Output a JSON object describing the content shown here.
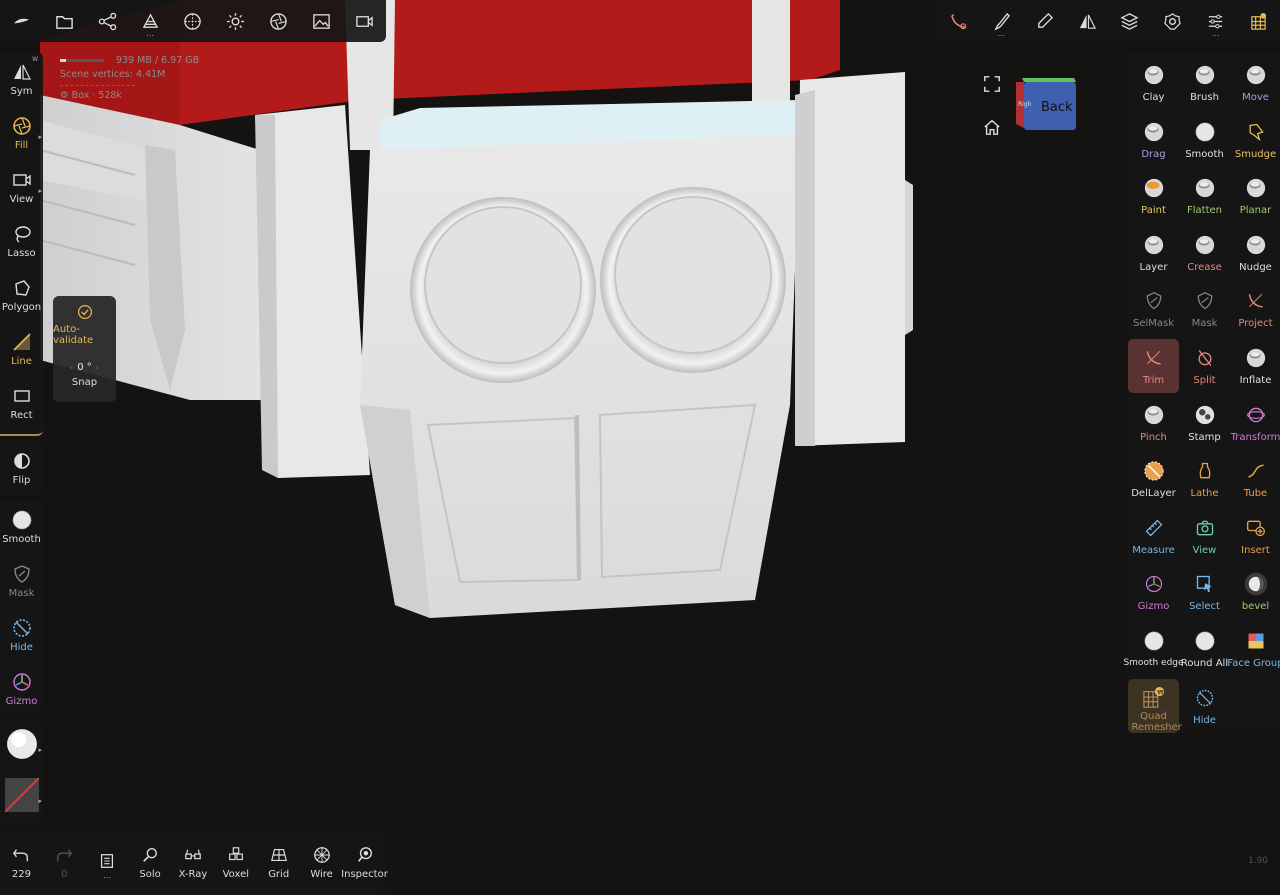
{
  "stats": {
    "memory": "939 MB / 6.97 GB",
    "memory_fraction": 0.13,
    "scene_vertices_label": "Scene vertices",
    "scene_vertices_value": "4.41M",
    "object_name": "Box",
    "object_vertices": "528k"
  },
  "top_left": [
    "nomad-logo",
    "open-folder",
    "scene-graph",
    "layers-stack",
    "wireframe-sphere",
    "sun-light",
    "camera-aperture",
    "image",
    "video-camera"
  ],
  "top_right": [
    "trim-tool",
    "paint-brush",
    "dropper",
    "symmetry",
    "layers",
    "settings",
    "sliders",
    "quad-remesher"
  ],
  "left_toolbar": {
    "sym": {
      "label": "Sym",
      "corner": "W"
    },
    "fill": {
      "label": "Fill"
    },
    "view": {
      "label": "View"
    },
    "lasso": {
      "label": "Lasso"
    },
    "polygon": {
      "label": "Polygon"
    },
    "line": {
      "label": "Line"
    },
    "rect": {
      "label": "Rect"
    },
    "flip": {
      "label": "Flip"
    },
    "smooth": {
      "label": "Smooth"
    },
    "mask": {
      "label": "Mask"
    },
    "hide": {
      "label": "Hide"
    },
    "gizmo": {
      "label": "Gizmo"
    }
  },
  "line_popup": {
    "auto_validate": "Auto-validate",
    "snap_value": "0 °",
    "snap_label": "Snap"
  },
  "view_cube": {
    "face": "Back"
  },
  "brushes": [
    {
      "label": "Clay",
      "color": "#e0e0e0"
    },
    {
      "label": "Brush",
      "color": "#e0e0e0"
    },
    {
      "label": "Move",
      "color": "#a99ee3"
    },
    {
      "label": "Drag",
      "color": "#a99ee3"
    },
    {
      "label": "Smooth",
      "color": "#e0e0e0"
    },
    {
      "label": "Smudge",
      "color": "#e8c461"
    },
    {
      "label": "Paint",
      "color": "#e8c461"
    },
    {
      "label": "Flatten",
      "color": "#9ecc70"
    },
    {
      "label": "Planar",
      "color": "#9ecc70"
    },
    {
      "label": "Layer",
      "color": "#e0e0e0"
    },
    {
      "label": "Crease",
      "color": "#e38a7e"
    },
    {
      "label": "Nudge",
      "color": "#e0e0e0"
    },
    {
      "label": "SelMask",
      "color": "#888888"
    },
    {
      "label": "Mask",
      "color": "#888888"
    },
    {
      "label": "Project",
      "color": "#e38a7e"
    },
    {
      "label": "Trim",
      "color": "#e38a7e"
    },
    {
      "label": "Split",
      "color": "#e38a7e"
    },
    {
      "label": "Inflate",
      "color": "#e0e0e0"
    },
    {
      "label": "Pinch",
      "color": "#e38a7e"
    },
    {
      "label": "Stamp",
      "color": "#e0e0e0"
    },
    {
      "label": "Transform",
      "color": "#d27ad6"
    },
    {
      "label": "DelLayer",
      "color": "#e0e0e0"
    },
    {
      "label": "Lathe",
      "color": "#e8a14d"
    },
    {
      "label": "Tube",
      "color": "#e8a14d"
    },
    {
      "label": "Measure",
      "color": "#79b9e8"
    },
    {
      "label": "View",
      "color": "#6ccfb8"
    },
    {
      "label": "Insert",
      "color": "#e8a14d"
    },
    {
      "label": "Gizmo",
      "color": "#d27ad6"
    },
    {
      "label": "Select",
      "color": "#79b9e8"
    },
    {
      "label": "bevel",
      "color": "#9ecc70"
    },
    {
      "label": "Smooth edge",
      "color": "#e0e0e0"
    },
    {
      "label": "Round All",
      "color": "#e0e0e0"
    },
    {
      "label": "Face Group",
      "color": "#79b9e8"
    },
    {
      "label": "Quad Remesher",
      "color": "#b08b55"
    },
    {
      "label": "Hide",
      "color": "#79b9e8"
    }
  ],
  "bottom_bar": {
    "undo": {
      "label": "229"
    },
    "redo": {
      "label": "0"
    },
    "solo": {
      "label": "Solo"
    },
    "xray": {
      "label": "X-Ray"
    },
    "voxel": {
      "label": "Voxel"
    },
    "grid": {
      "label": "Grid"
    },
    "wire": {
      "label": "Wire"
    },
    "inspector": {
      "label": "Inspector"
    }
  },
  "version": "1.90",
  "colors": {
    "accent": "#e8b654",
    "active_tool_bg": "#5a3232",
    "model_red": "#b31b1b"
  }
}
